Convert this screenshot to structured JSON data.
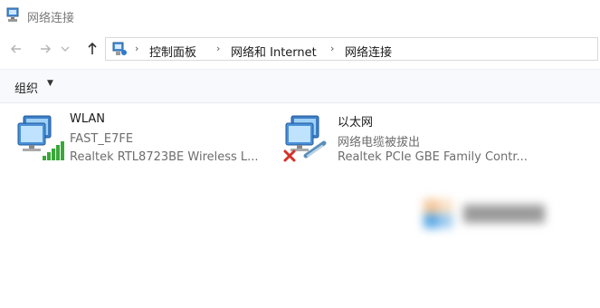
{
  "window": {
    "title": "网络连接",
    "icon": "network-connections-icon"
  },
  "navigation": {
    "back_icon": "arrow-left-icon",
    "forward_icon": "arrow-right-icon",
    "up_icon": "arrow-up-icon"
  },
  "address_bar": {
    "icon": "control-panel-icon",
    "breadcrumbs": [
      "控制面板",
      "网络和 Internet",
      "网络连接"
    ]
  },
  "command_bar": {
    "organize_label": "组织",
    "organize_arrow": "▼"
  },
  "connections": [
    {
      "name": "WLAN",
      "status": "FAST_E7FE",
      "device": "Realtek RTL8723BE Wireless L...",
      "icon": "wireless-adapter-icon",
      "overlay": "signal-bars-icon"
    },
    {
      "name": "以太网",
      "status": "网络电缆被拔出",
      "device": "Realtek PCIe GBE Family Contr...",
      "icon": "ethernet-adapter-icon",
      "overlay": "disconnected-x-icon"
    }
  ],
  "colors": {
    "signal_green": "#3aa83a",
    "error_red": "#d4312a",
    "monitor_blue": "#4a90d9"
  }
}
